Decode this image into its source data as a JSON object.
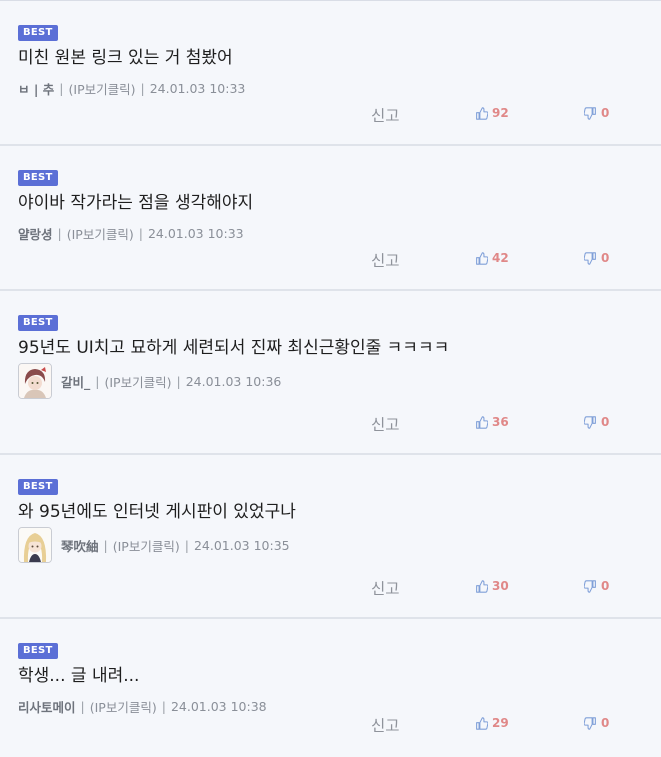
{
  "comments": [
    {
      "badge": "BEST",
      "text": "미친 원본 링크 있는 거 첨봤어",
      "author": "ㅂ | 추",
      "ip_label": "(IP보기클릭)",
      "timestamp": "24.01.03 10:33",
      "report_label": "신고",
      "likes": "92",
      "dislikes": "0",
      "has_avatar": false
    },
    {
      "badge": "BEST",
      "text": "야이바 작가라는 점을 생각해야지",
      "author": "얄랑셩",
      "ip_label": "(IP보기클릭)",
      "timestamp": "24.01.03 10:33",
      "report_label": "신고",
      "likes": "42",
      "dislikes": "0",
      "has_avatar": false
    },
    {
      "badge": "BEST",
      "text": "95년도 UI치고 묘하게 세련되서 진짜 최신근황인줄 ㅋㅋㅋㅋ",
      "author": "갈비_",
      "ip_label": "(IP보기클릭)",
      "timestamp": "24.01.03 10:36",
      "report_label": "신고",
      "likes": "36",
      "dislikes": "0",
      "has_avatar": true
    },
    {
      "badge": "BEST",
      "text": "와 95년에도 인터넷 게시판이 있었구나",
      "author": "琴吹紬",
      "ip_label": "(IP보기클릭)",
      "timestamp": "24.01.03 10:35",
      "report_label": "신고",
      "likes": "30",
      "dislikes": "0",
      "has_avatar": true
    },
    {
      "badge": "BEST",
      "text": "학생... 글 내려...",
      "author": "리사토메이",
      "ip_label": "(IP보기클릭)",
      "timestamp": "24.01.03 10:38",
      "report_label": "신고",
      "likes": "29",
      "dislikes": "0",
      "has_avatar": false
    }
  ],
  "icons": {
    "thumbs_up": "thumbs-up-icon",
    "thumbs_down": "thumbs-down-icon"
  },
  "colors": {
    "badge_bg": "#5b6fd6",
    "vote_count": "#e08888",
    "icon": "#7f9fd8"
  }
}
